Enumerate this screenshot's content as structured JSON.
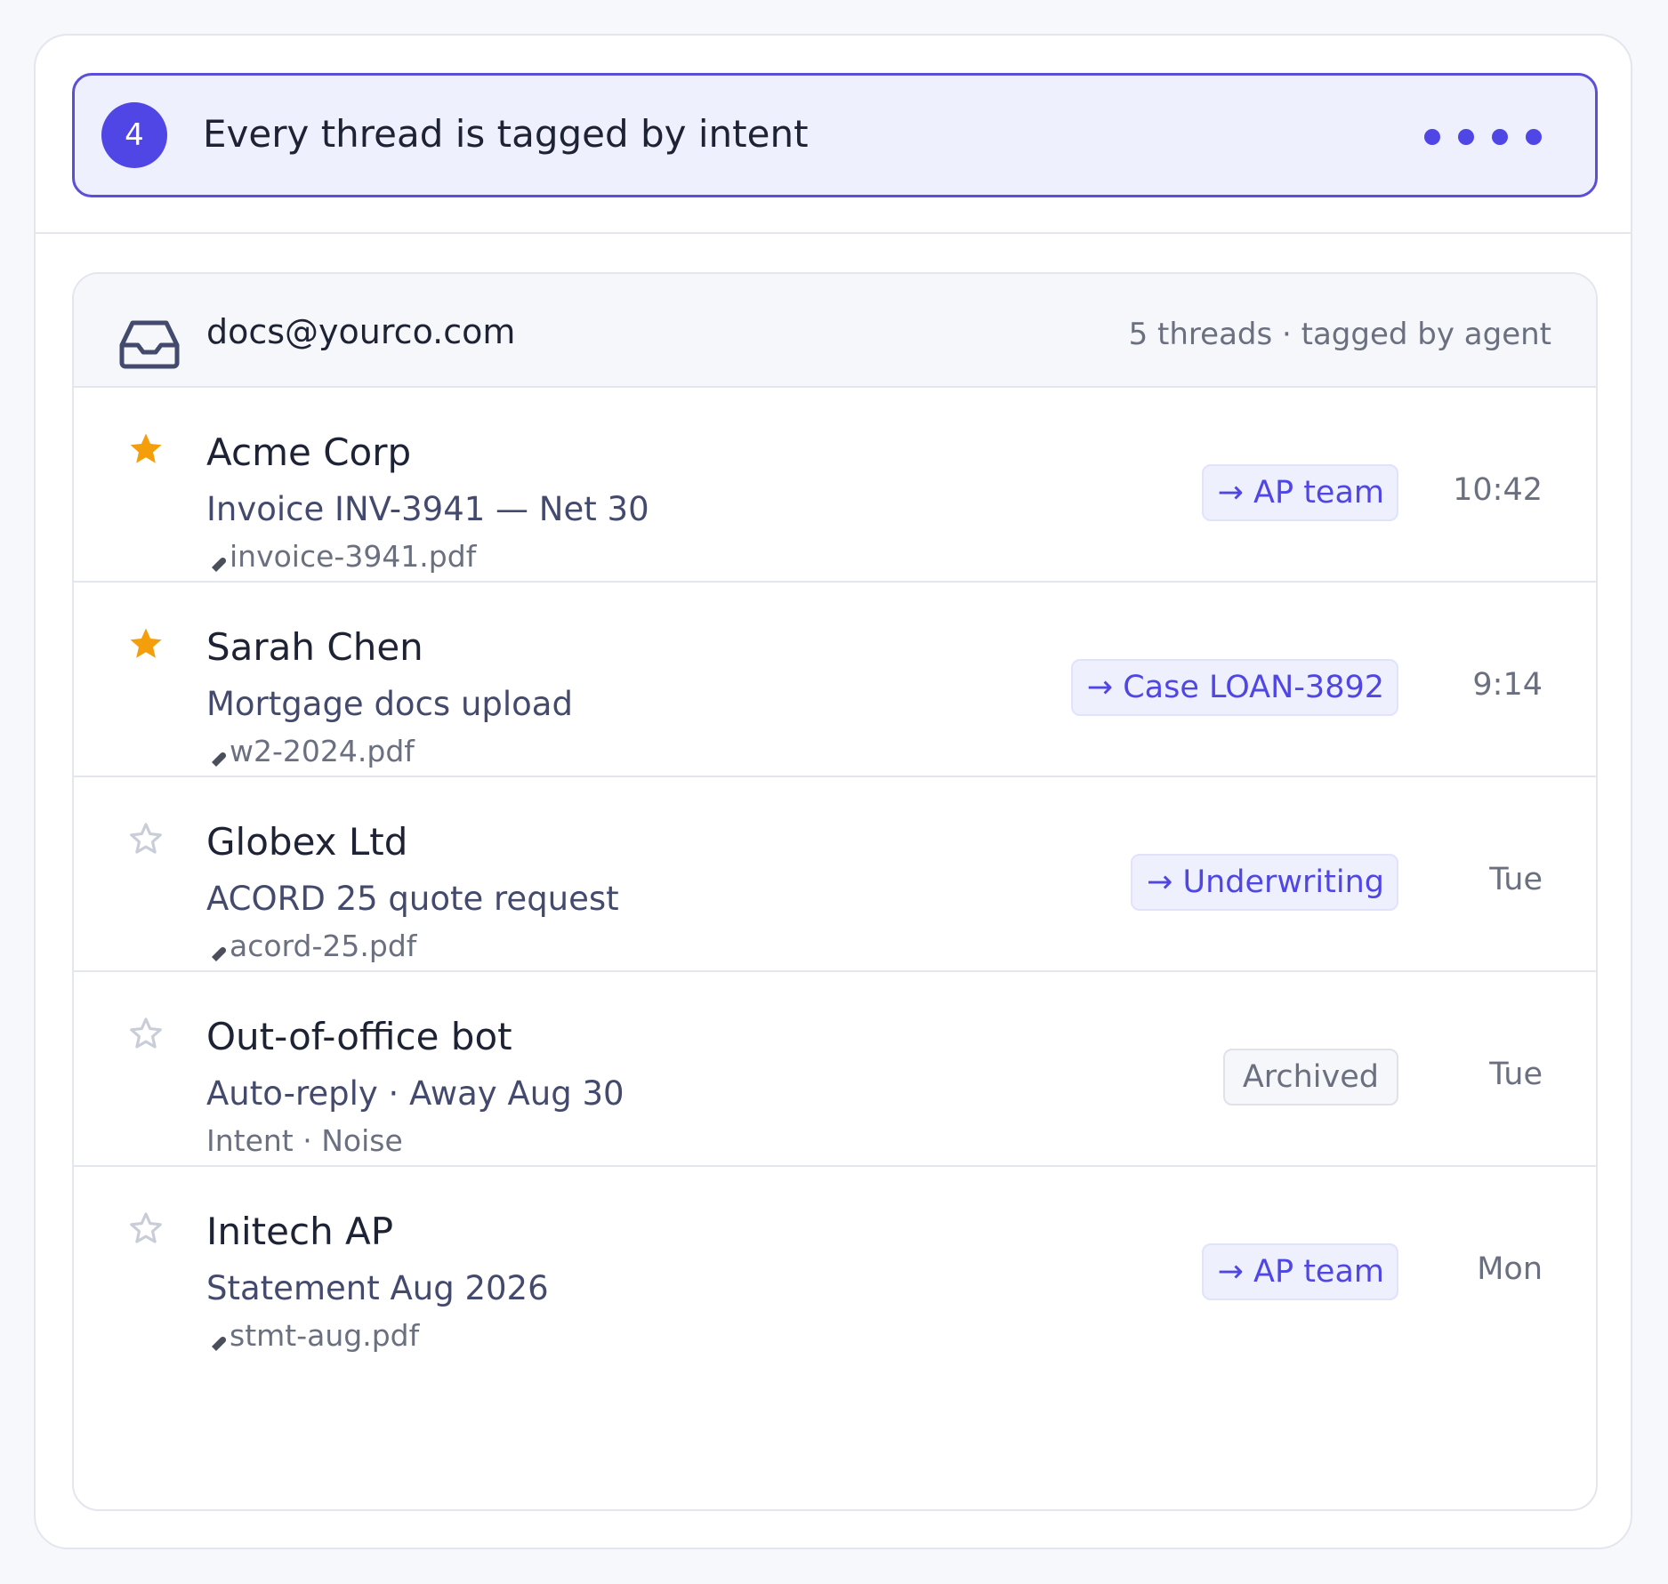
{
  "step": {
    "number": "4",
    "title": "Every thread is tagged by intent",
    "progress_dots": 4,
    "accent": "#4f46e5"
  },
  "inbox": {
    "icon": "inbox-icon",
    "address": "docs@yourco.com",
    "meta": "5 threads · tagged by agent"
  },
  "threads": [
    {
      "starred": true,
      "sender": "Acme Corp",
      "subject": "Invoice INV-3941 — Net 30",
      "attachment": "invoice-3941.pdf",
      "route": "→ AP team",
      "time": "10:42"
    },
    {
      "starred": true,
      "sender": "Sarah Chen",
      "subject": "Mortgage docs upload",
      "attachment": "w2-2024.pdf",
      "route": "→ Case LOAN-3892",
      "time": "9:14"
    },
    {
      "starred": false,
      "sender": "Globex Ltd",
      "subject": "ACORD 25 quote request",
      "attachment": "acord-25.pdf",
      "route": "→ Underwriting",
      "time": "Tue"
    },
    {
      "starred": false,
      "sender": "Out-of-office bot",
      "subject": "Auto-reply · Away Aug 30",
      "intent": "Intent · Noise",
      "route": "Archived",
      "time": "Tue"
    },
    {
      "starred": false,
      "sender": "Initech AP",
      "subject": "Statement Aug 2026",
      "attachment": "stmt-aug.pdf",
      "route": "→ AP team",
      "time": "Mon"
    }
  ],
  "colors": {
    "star_filled": "#f59e0b",
    "star_empty": "#c9cdd8",
    "tag_text": "#4f46e5",
    "tag_bg": "#eef0fd"
  }
}
